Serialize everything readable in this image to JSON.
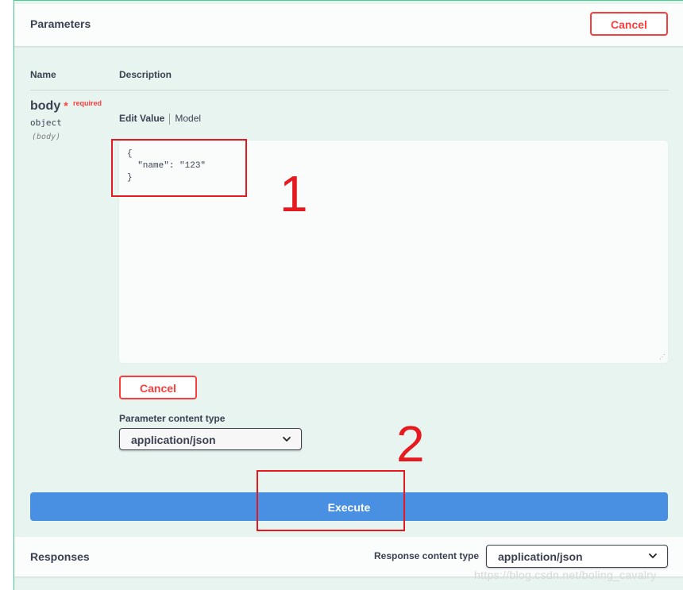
{
  "parameters": {
    "title": "Parameters",
    "cancel_label": "Cancel",
    "col_name": "Name",
    "col_description": "Description",
    "param": {
      "name": "body",
      "star": "*",
      "required": "required",
      "type": "object",
      "in": "(body)"
    },
    "tabs": {
      "edit_value": "Edit Value",
      "model": "Model"
    },
    "editor_value": "{\n  \"name\": \"123\"\n}",
    "body_cancel_label": "Cancel",
    "content_type_label": "Parameter content type",
    "content_type_value": "application/json",
    "execute_label": "Execute"
  },
  "responses": {
    "title": "Responses",
    "content_type_label": "Response content type",
    "content_type_value": "application/json"
  },
  "annotations": {
    "one": "1",
    "two": "2"
  },
  "watermark": "https://blog.csdn.net/boling_cavalry",
  "colors": {
    "accent_green": "#49cc90",
    "cancel_red": "#f93e3e",
    "execute_blue": "#4990e2",
    "annotation_red": "#e5191f"
  },
  "icons": [
    "chevron-down-icon",
    "resize-handle-icon"
  ]
}
